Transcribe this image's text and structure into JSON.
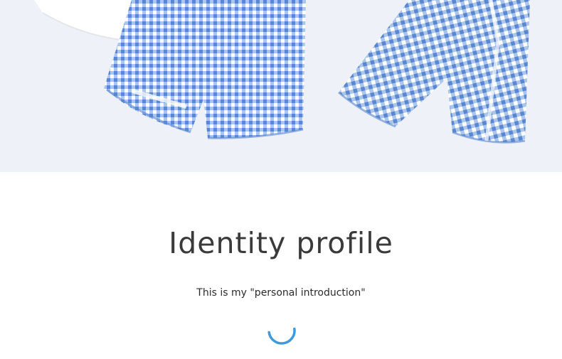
{
  "product": {
    "image_alt": "blue-white-gingham-pajama-pants"
  },
  "section": {
    "title": "Identity profile",
    "subtitle": "This is my \"personal introduction\""
  },
  "colors": {
    "hero_background": "#eef2f8",
    "gingham_blue": "#6f9ad8",
    "title_text": "#3a3a3a",
    "spinner": "#3d9bdc"
  },
  "icons": {
    "loading": "loading-spinner-icon"
  }
}
